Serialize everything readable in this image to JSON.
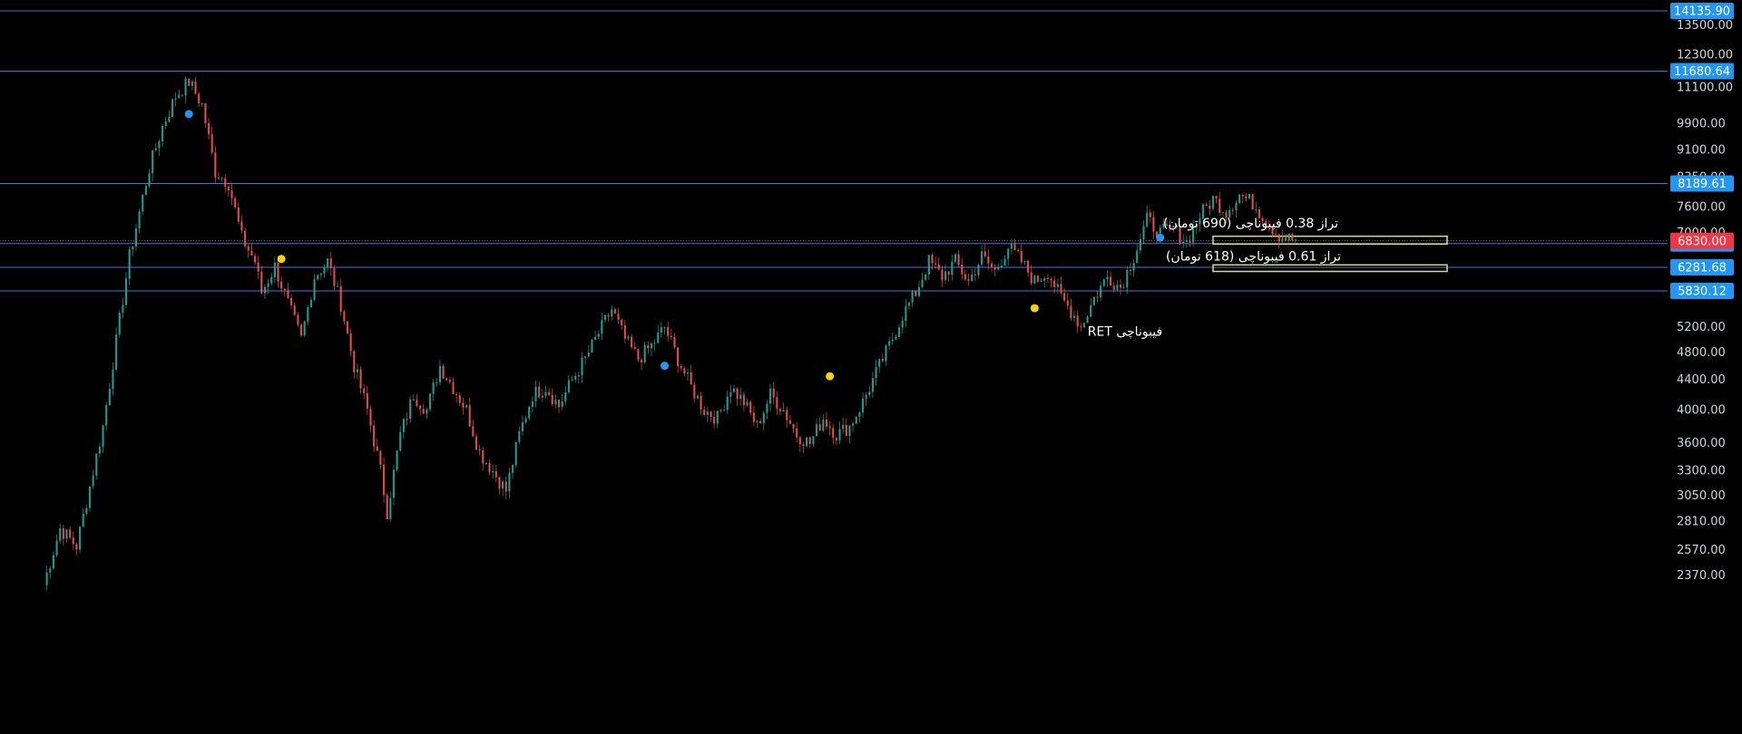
{
  "colors": {
    "background": "#000000",
    "up_candle": "#26a69a",
    "down_candle": "#ef5350",
    "level_line": "#4a74d6",
    "price_badge": "#2196f3",
    "current_price_badge": "#f23645",
    "fib_box": "#d9d98c",
    "marker_blue": "#2196f3",
    "marker_yellow": "#f5d20a",
    "axis_text": "#d1d4dc"
  },
  "chart_data": {
    "type": "candlestick",
    "y_scale": "log",
    "ylim": [
      2200,
      15000
    ],
    "y_ticks": [
      "13500.00",
      "12300.00",
      "11100.00",
      "9900.00",
      "9100.00",
      "8350.00",
      "7600.00",
      "7000.00",
      "5200.00",
      "4800.00",
      "4400.00",
      "4000.00",
      "3600.00",
      "3300.00",
      "3050.00",
      "2810.00",
      "2570.00",
      "2370.00"
    ],
    "levels": [
      {
        "label": "14135.90",
        "value": 14135.9
      },
      {
        "label": "11680.64",
        "value": 11680.64
      },
      {
        "label": "8189.61",
        "value": 8189.61
      },
      {
        "label": "6771.74",
        "value": 6771.74
      },
      {
        "label": "6281.68",
        "value": 6281.68
      },
      {
        "label": "5830.12",
        "value": 5830.12
      }
    ],
    "current_price": {
      "label": "6830.00",
      "value": 6830
    },
    "path": [
      {
        "i": 0,
        "p": 2300
      },
      {
        "i": 5,
        "p": 2750
      },
      {
        "i": 10,
        "p": 2600
      },
      {
        "i": 18,
        "p": 3800
      },
      {
        "i": 26,
        "p": 6500
      },
      {
        "i": 32,
        "p": 8600
      },
      {
        "i": 36,
        "p": 9800
      },
      {
        "i": 40,
        "p": 10800
      },
      {
        "i": 44,
        "p": 11300
      },
      {
        "i": 48,
        "p": 10500
      },
      {
        "i": 52,
        "p": 8500
      },
      {
        "i": 56,
        "p": 8200
      },
      {
        "i": 60,
        "p": 6900
      },
      {
        "i": 64,
        "p": 6400
      },
      {
        "i": 66,
        "p": 5800
      },
      {
        "i": 70,
        "p": 6300
      },
      {
        "i": 74,
        "p": 5600
      },
      {
        "i": 78,
        "p": 5000
      },
      {
        "i": 82,
        "p": 6100
      },
      {
        "i": 86,
        "p": 6400
      },
      {
        "i": 90,
        "p": 5600
      },
      {
        "i": 94,
        "p": 4600
      },
      {
        "i": 98,
        "p": 4000
      },
      {
        "i": 102,
        "p": 3300
      },
      {
        "i": 104,
        "p": 2900
      },
      {
        "i": 108,
        "p": 3700
      },
      {
        "i": 112,
        "p": 4200
      },
      {
        "i": 116,
        "p": 4000
      },
      {
        "i": 120,
        "p": 4600
      },
      {
        "i": 124,
        "p": 4300
      },
      {
        "i": 128,
        "p": 4000
      },
      {
        "i": 132,
        "p": 3500
      },
      {
        "i": 136,
        "p": 3300
      },
      {
        "i": 140,
        "p": 3100
      },
      {
        "i": 144,
        "p": 3700
      },
      {
        "i": 148,
        "p": 4200
      },
      {
        "i": 152,
        "p": 4300
      },
      {
        "i": 156,
        "p": 4050
      },
      {
        "i": 160,
        "p": 4400
      },
      {
        "i": 164,
        "p": 4700
      },
      {
        "i": 168,
        "p": 5100
      },
      {
        "i": 172,
        "p": 5500
      },
      {
        "i": 176,
        "p": 5000
      },
      {
        "i": 180,
        "p": 4700
      },
      {
        "i": 184,
        "p": 4900
      },
      {
        "i": 188,
        "p": 5200
      },
      {
        "i": 192,
        "p": 4700
      },
      {
        "i": 196,
        "p": 4300
      },
      {
        "i": 200,
        "p": 4000
      },
      {
        "i": 204,
        "p": 3900
      },
      {
        "i": 208,
        "p": 4300
      },
      {
        "i": 212,
        "p": 4100
      },
      {
        "i": 216,
        "p": 3800
      },
      {
        "i": 220,
        "p": 4200
      },
      {
        "i": 224,
        "p": 4000
      },
      {
        "i": 228,
        "p": 3700
      },
      {
        "i": 232,
        "p": 3600
      },
      {
        "i": 236,
        "p": 3900
      },
      {
        "i": 240,
        "p": 3700
      },
      {
        "i": 244,
        "p": 3800
      },
      {
        "i": 248,
        "p": 4100
      },
      {
        "i": 252,
        "p": 4500
      },
      {
        "i": 256,
        "p": 4900
      },
      {
        "i": 260,
        "p": 5400
      },
      {
        "i": 264,
        "p": 5800
      },
      {
        "i": 268,
        "p": 6400
      },
      {
        "i": 272,
        "p": 6100
      },
      {
        "i": 276,
        "p": 6400
      },
      {
        "i": 280,
        "p": 6000
      },
      {
        "i": 284,
        "p": 6500
      },
      {
        "i": 288,
        "p": 6200
      },
      {
        "i": 292,
        "p": 6700
      },
      {
        "i": 296,
        "p": 6400
      },
      {
        "i": 300,
        "p": 6000
      },
      {
        "i": 304,
        "p": 6200
      },
      {
        "i": 308,
        "p": 5700
      },
      {
        "i": 312,
        "p": 5400
      },
      {
        "i": 314,
        "p": 5200
      },
      {
        "i": 318,
        "p": 5700
      },
      {
        "i": 322,
        "p": 6100
      },
      {
        "i": 326,
        "p": 5900
      },
      {
        "i": 330,
        "p": 6500
      },
      {
        "i": 334,
        "p": 7300
      },
      {
        "i": 338,
        "p": 7000
      },
      {
        "i": 342,
        "p": 7100
      },
      {
        "i": 346,
        "p": 6800
      },
      {
        "i": 350,
        "p": 7400
      },
      {
        "i": 354,
        "p": 7800
      },
      {
        "i": 358,
        "p": 7500
      },
      {
        "i": 362,
        "p": 7900
      },
      {
        "i": 366,
        "p": 7700
      },
      {
        "i": 370,
        "p": 7300
      },
      {
        "i": 374,
        "p": 6950
      },
      {
        "i": 378,
        "p": 6850
      }
    ],
    "n_candles": 380,
    "markers": [
      {
        "i": 44,
        "p": 10200,
        "color": "blue"
      },
      {
        "i": 72,
        "p": 6450,
        "color": "yellow"
      },
      {
        "i": 188,
        "p": 4600,
        "color": "blue"
      },
      {
        "i": 238,
        "p": 4450,
        "color": "yellow"
      },
      {
        "i": 300,
        "p": 5520,
        "color": "yellow"
      },
      {
        "i": 338,
        "p": 6900,
        "color": "blue"
      }
    ],
    "annotations": [
      {
        "text": "تراز 0.38 فیبوناچی (690 تومان)"
      },
      {
        "text": "تراز 0.61 فیبوناچی (618 تومان)"
      },
      {
        "text": "RET فیبوناچی"
      }
    ]
  }
}
